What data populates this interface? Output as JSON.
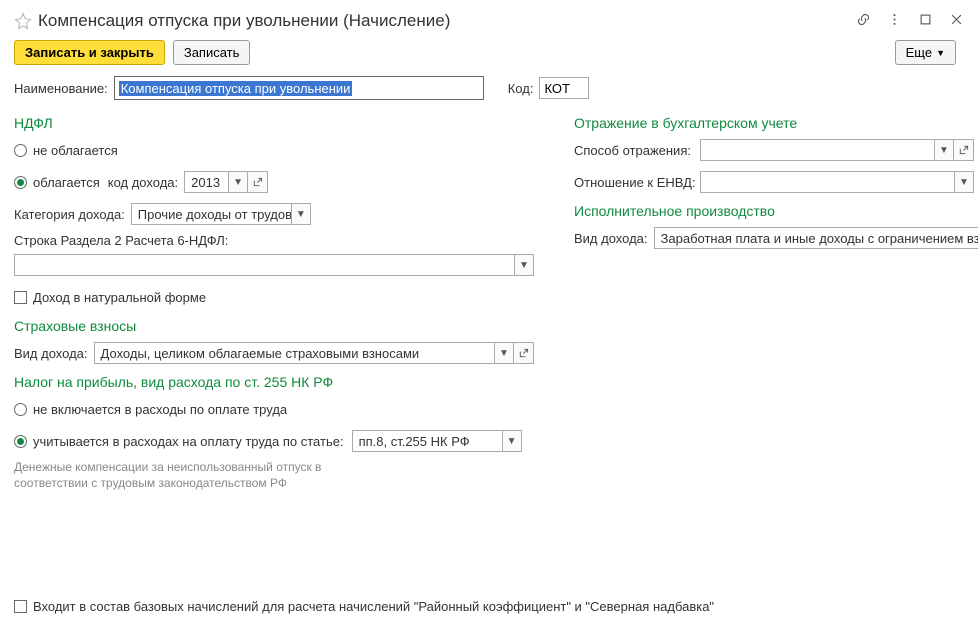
{
  "title": "Компенсация отпуска при увольнении (Начисление)",
  "toolbar": {
    "save_close": "Записать и закрыть",
    "save": "Записать",
    "more": "Еще"
  },
  "name": {
    "label": "Наименование:",
    "value": "Компенсация отпуска при увольнении"
  },
  "code": {
    "label": "Код:",
    "value": "КОТ"
  },
  "ndfl": {
    "title": "НДФЛ",
    "not_taxed": "не облагается",
    "taxed": "облагается",
    "income_code_label": "код дохода:",
    "income_code_value": "2013",
    "category_label": "Категория дохода:",
    "category_value": "Прочие доходы от трудов",
    "section2_label": "Строка Раздела 2 Расчета 6-НДФЛ:",
    "section2_value": "",
    "in_kind": "Доход в натуральной форме"
  },
  "insurance": {
    "title": "Страховые взносы",
    "income_type_label": "Вид дохода:",
    "income_type_value": "Доходы, целиком облагаемые страховыми взносами"
  },
  "profit_tax": {
    "title": "Налог на прибыль, вид расхода по ст. 255 НК РФ",
    "not_included": "не включается в расходы по оплате труда",
    "included": "учитывается в расходах на оплату труда по статье:",
    "article_value": "пп.8, ст.255 НК РФ",
    "hint": "Денежные компенсации за неиспользованный отпуск в соответствии с трудовым законодательством РФ"
  },
  "accounting": {
    "title": "Отражение в бухгалтерском учете",
    "method_label": "Способ отражения:",
    "method_value": "",
    "envd_label": "Отношение к ЕНВД:",
    "envd_value": ""
  },
  "enforcement": {
    "title": "Исполнительное производство",
    "income_type_label": "Вид дохода:",
    "income_type_value": "Заработная плата и иные доходы с ограничением взыскан"
  },
  "footer": {
    "base_accruals": "Входит в состав базовых начислений для расчета начислений \"Районный коэффициент\" и \"Северная надбавка\""
  }
}
